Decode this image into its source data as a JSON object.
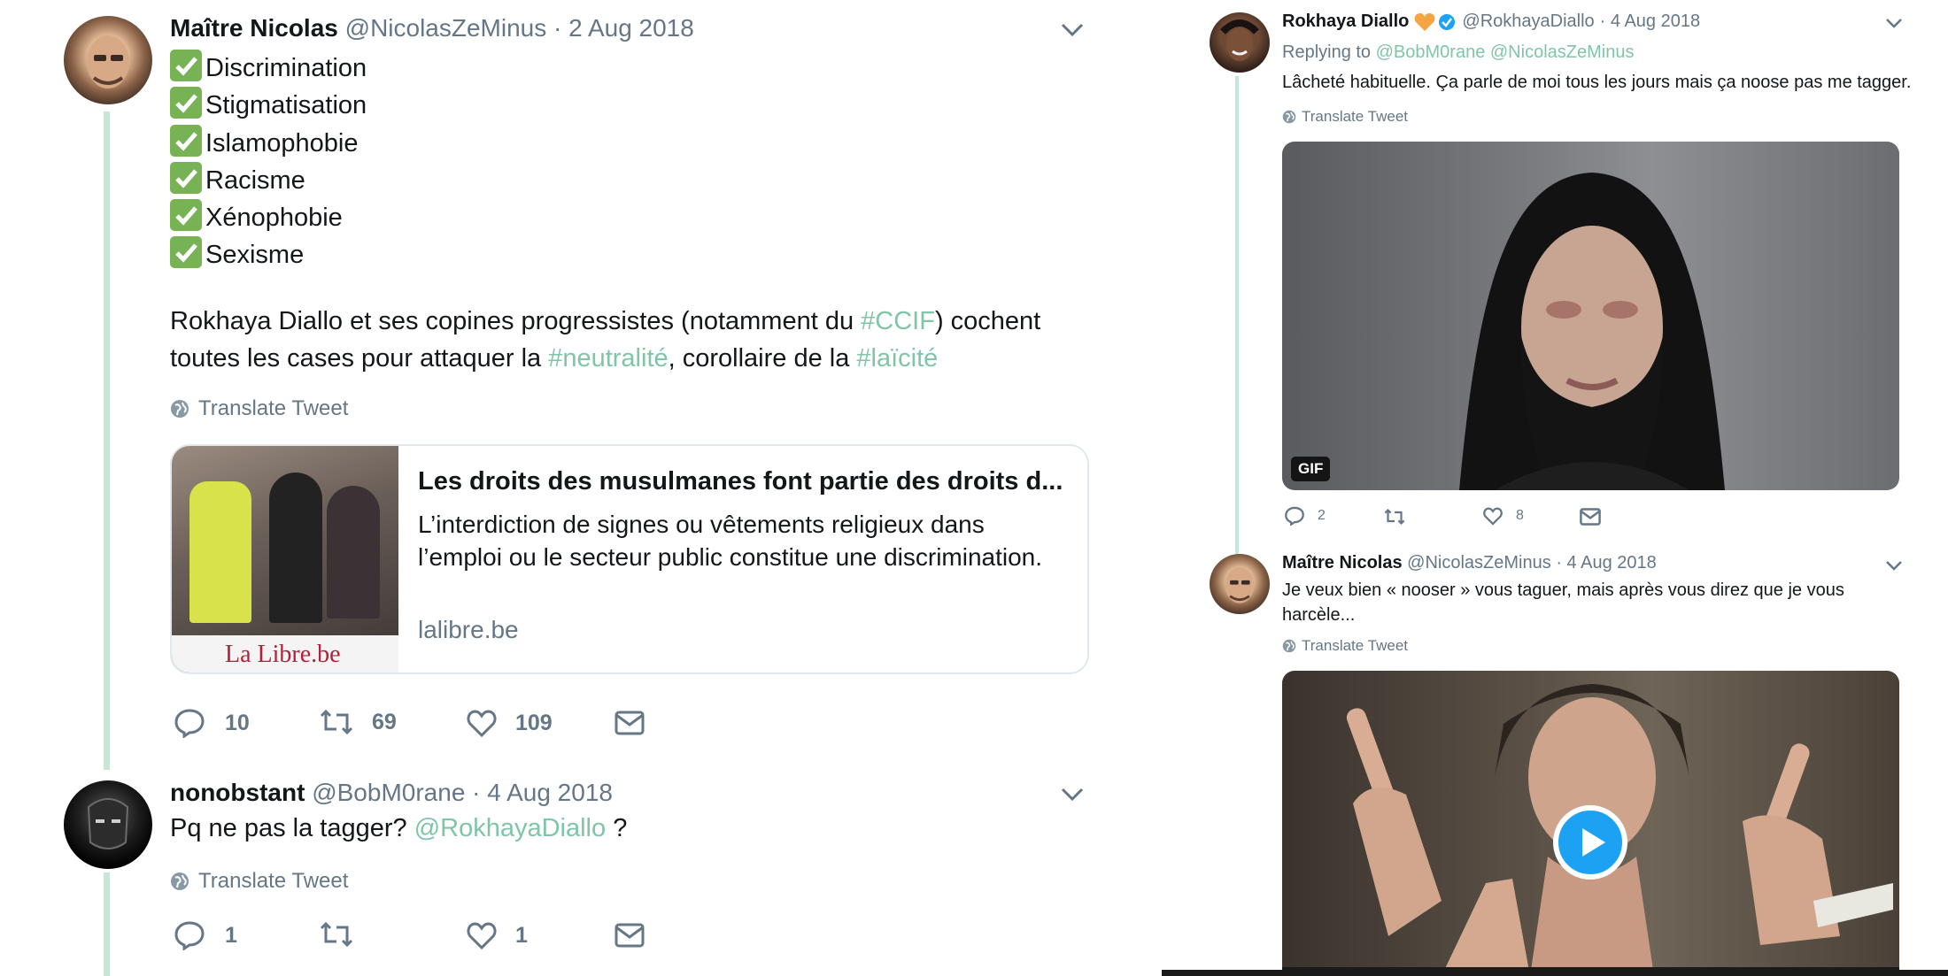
{
  "left": {
    "tweet1": {
      "name": "Maître Nicolas",
      "handle": "@NicolasZeMinus",
      "date": "· 2 Aug 2018",
      "checklist": [
        "Discrimination",
        "Stigmatisation",
        "Islamophobie",
        "Racisme",
        "Xénophobie",
        "Sexisme"
      ],
      "body1_a": "Rokhaya Diallo et ses copines progressistes (notamment du ",
      "hash1": "#CCIF",
      "body1_b": ") cochent",
      "body2_a": "toutes les cases pour attaquer la ",
      "hash2": "#neutralité",
      "body2_b": ", corollaire de la ",
      "hash3": "#laïcité",
      "translate": "Translate Tweet",
      "card": {
        "title": "Les droits des musulmanes font partie des droits d...",
        "desc": "L’interdiction de signes ou vêtements religieux dans l’emploi ou le secteur public constitue une discrimination.",
        "domain": "lalibre.be",
        "logo": "La Libre.be"
      },
      "replies": "10",
      "retweets": "69",
      "likes": "109"
    },
    "tweet2": {
      "name": "nonobstant",
      "handle": "@BobM0rane",
      "date": "· 4 Aug 2018",
      "body_a": "Pq ne pas la tagger? ",
      "mention": "@RokhayaDiallo",
      "body_b": " ?",
      "translate": "Translate Tweet",
      "replies": "1",
      "retweets": "",
      "likes": "1"
    }
  },
  "right": {
    "tweet1": {
      "name": "Rokhaya Diallo",
      "handle": "@RokhayaDiallo",
      "date": "· 4 Aug 2018",
      "replying_label": "Replying to ",
      "replying_to": "@BobM0rane @NicolasZeMinus",
      "body": "Lâcheté habituelle. Ça parle de moi tous les jours mais ça noose pas me tagger.",
      "translate": "Translate Tweet",
      "gif_label": "GIF",
      "replies": "2",
      "likes": "8"
    },
    "tweet2": {
      "name": "Maître Nicolas",
      "handle": "@NicolasZeMinus",
      "date": "· 4 Aug 2018",
      "body": "Je veux bien « nooser » vous taguer, mais après vous direz que je vous harcèle...",
      "translate": "Translate Tweet"
    }
  },
  "colors": {
    "hashtag": "#7fc6a8",
    "thread": "#c4e8d8",
    "muted": "#657786",
    "play": "#1da1f2",
    "check": "#77b255"
  },
  "icons": [
    "reply-icon",
    "retweet-icon",
    "like-icon",
    "message-icon",
    "chevron-down-icon",
    "globe-icon",
    "verified-icon",
    "heart-emoji-icon",
    "checkmark-icon",
    "play-icon"
  ]
}
